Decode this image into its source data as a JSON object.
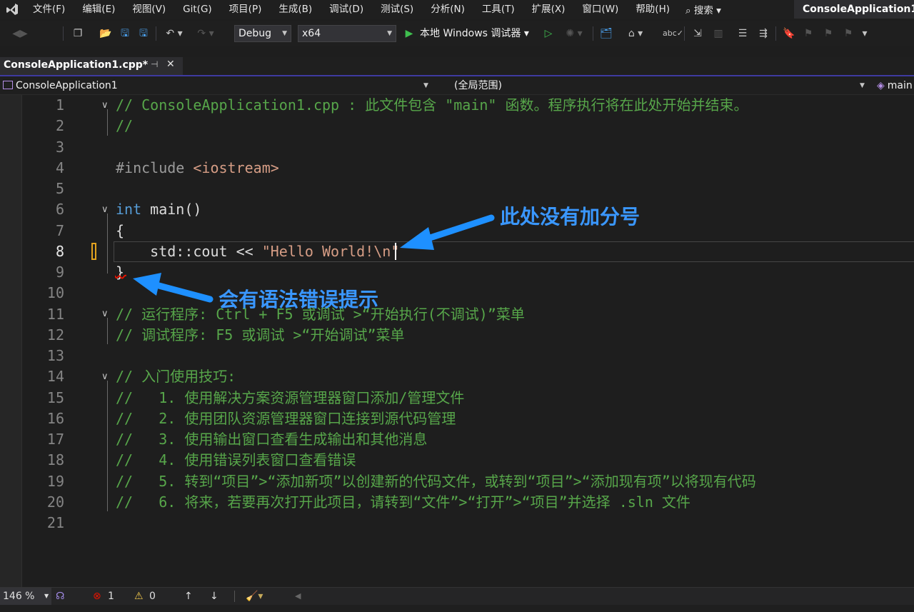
{
  "menubar": {
    "items": [
      "文件(F)",
      "编辑(E)",
      "视图(V)",
      "Git(G)",
      "项目(P)",
      "生成(B)",
      "调试(D)",
      "测试(S)",
      "分析(N)",
      "工具(T)",
      "扩展(X)",
      "窗口(W)",
      "帮助(H)"
    ],
    "search_label": "⌕ 搜索 ▾",
    "solution_title": "ConsoleApplication1"
  },
  "toolbar": {
    "config": "Debug",
    "platform": "x64",
    "run_label": "本地 Windows 调试器 ▾"
  },
  "tab": {
    "label": "ConsoleApplication1.cpp*",
    "pin": "⊣",
    "close": "✕"
  },
  "navbar": {
    "project": "ConsoleApplication1",
    "scope": "(全局范围)",
    "member": "main"
  },
  "editor": {
    "lines": [
      {
        "n": "1",
        "parts": [
          {
            "t": "// ConsoleApplication1.cpp : 此文件包含 \"main\" 函数。程序执行将在此处开始并结束。",
            "c": "cmt"
          }
        ]
      },
      {
        "n": "2",
        "parts": [
          {
            "t": "//",
            "c": "cmt"
          }
        ]
      },
      {
        "n": "3",
        "parts": []
      },
      {
        "n": "4",
        "parts": [
          {
            "t": "#include ",
            "c": "pp"
          },
          {
            "t": "<iostream>",
            "c": "str"
          }
        ]
      },
      {
        "n": "5",
        "parts": []
      },
      {
        "n": "6",
        "parts": [
          {
            "t": "int",
            "c": "kw"
          },
          {
            "t": " main()",
            "c": ""
          }
        ]
      },
      {
        "n": "7",
        "parts": [
          {
            "t": "{",
            "c": ""
          }
        ]
      },
      {
        "n": "8",
        "parts": [
          {
            "t": "    std::cout << ",
            "c": ""
          },
          {
            "t": "\"Hello World!\\n\"",
            "c": "str"
          }
        ]
      },
      {
        "n": "9",
        "parts": [
          {
            "t": "}",
            "c": ""
          }
        ]
      },
      {
        "n": "10",
        "parts": []
      },
      {
        "n": "11",
        "parts": [
          {
            "t": "// 运行程序: Ctrl + F5 或调试 >“开始执行(不调试)”菜单",
            "c": "cmt"
          }
        ]
      },
      {
        "n": "12",
        "parts": [
          {
            "t": "// 调试程序: F5 或调试 >“开始调试”菜单",
            "c": "cmt"
          }
        ]
      },
      {
        "n": "13",
        "parts": []
      },
      {
        "n": "14",
        "parts": [
          {
            "t": "// 入门使用技巧:",
            "c": "cmt"
          }
        ]
      },
      {
        "n": "15",
        "parts": [
          {
            "t": "//   1. 使用解决方案资源管理器窗口添加/管理文件",
            "c": "cmt"
          }
        ]
      },
      {
        "n": "16",
        "parts": [
          {
            "t": "//   2. 使用团队资源管理器窗口连接到源代码管理",
            "c": "cmt"
          }
        ]
      },
      {
        "n": "17",
        "parts": [
          {
            "t": "//   3. 使用输出窗口查看生成输出和其他消息",
            "c": "cmt"
          }
        ]
      },
      {
        "n": "18",
        "parts": [
          {
            "t": "//   4. 使用错误列表窗口查看错误",
            "c": "cmt"
          }
        ]
      },
      {
        "n": "19",
        "parts": [
          {
            "t": "//   5. 转到“项目”>“添加新项”以创建新的代码文件，或转到“项目”>“添加现有项”以将现有代码",
            "c": "cmt"
          }
        ]
      },
      {
        "n": "20",
        "parts": [
          {
            "t": "//   6. 将来，若要再次打开此项目，请转到“文件”>“打开”>“项目”并选择 .sln 文件",
            "c": "cmt"
          }
        ]
      },
      {
        "n": "21",
        "parts": []
      }
    ],
    "active_line": "8"
  },
  "annotations": {
    "missing_semicolon": "此处没有加分号",
    "syntax_error_hint": "会有语法错误提示"
  },
  "statusbar": {
    "zoom": "146 %",
    "errors": "1",
    "warnings": "0"
  },
  "colors": {
    "comment": "#57a64a",
    "keyword": "#569cd6",
    "string": "#d69d85",
    "annotation": "#3a97ff",
    "accent_tab": "#3e3aa0",
    "error_red": "#e51400"
  }
}
